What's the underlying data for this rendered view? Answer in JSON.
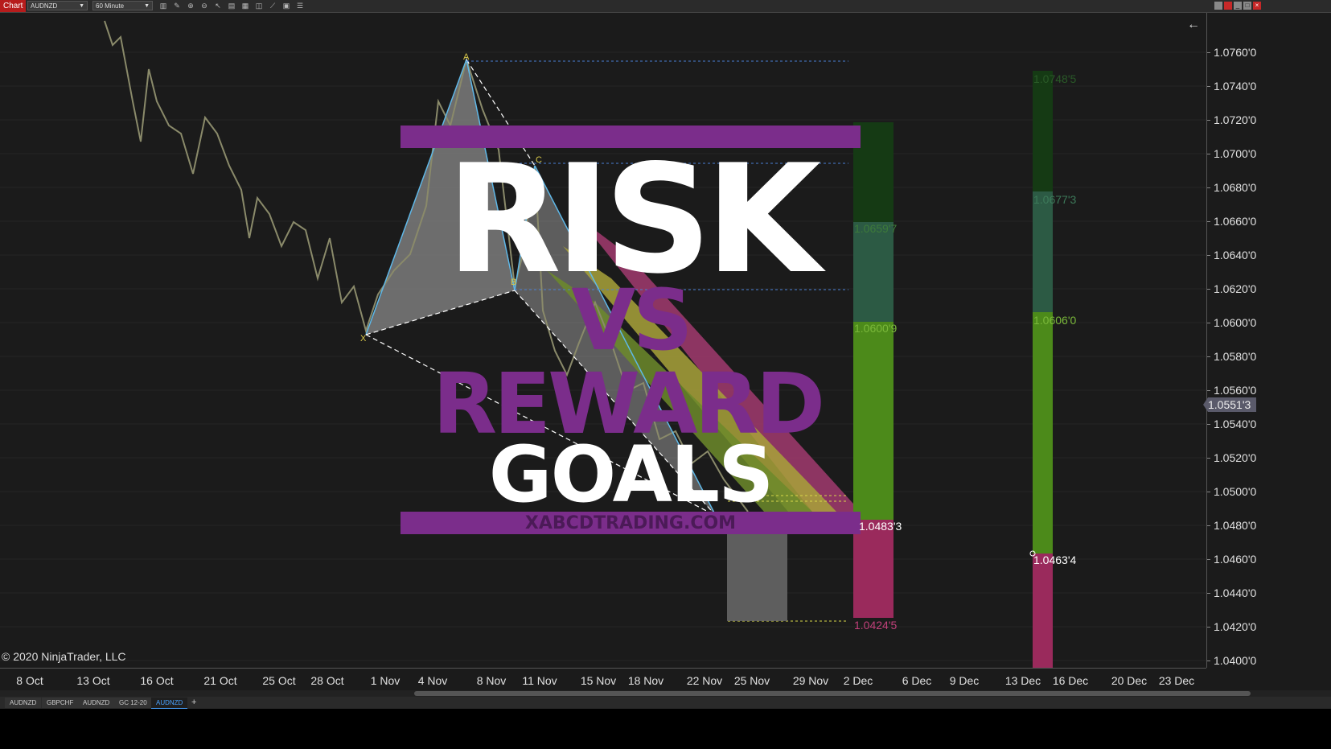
{
  "toolbar": {
    "chart_label": "Chart",
    "instrument": "AUDNZD",
    "interval": "60 Minute",
    "icons": [
      "bars-icon",
      "draw-icon",
      "zoom-in-icon",
      "zoom-out-icon",
      "pointer-icon",
      "properties-icon",
      "templates-icon",
      "snapshot-icon",
      "strategy-icon",
      "calculator-icon",
      "list-icon"
    ]
  },
  "chart": {
    "copyright": "© 2020 NinjaTrader, LLC",
    "current_price": "1.0551'3",
    "price_axis": [
      "1.0760'0",
      "1.0740'0",
      "1.0720'0",
      "1.0700'0",
      "1.0680'0",
      "1.0660'0",
      "1.0640'0",
      "1.0620'0",
      "1.0600'0",
      "1.0580'0",
      "1.0560'0",
      "1.0540'0",
      "1.0520'0",
      "1.0500'0",
      "1.0480'0",
      "1.0460'0",
      "1.0440'0",
      "1.0420'0",
      "1.0400'0"
    ],
    "time_axis": [
      "8 Oct",
      "13 Oct",
      "16 Oct",
      "21 Oct",
      "25 Oct",
      "28 Oct",
      "1 Nov",
      "4 Nov",
      "8 Nov",
      "11 Nov",
      "15 Nov",
      "18 Nov",
      "22 Nov",
      "25 Nov",
      "29 Nov",
      "2 Dec",
      "6 Dec",
      "9 Dec",
      "13 Dec",
      "16 Dec",
      "20 Dec",
      "23 Dec"
    ],
    "pattern_points": [
      "X",
      "A",
      "B",
      "C"
    ],
    "levels_left": [
      "1.0659'7",
      "1.0600'9",
      "1.0483'3",
      "1.0424'5"
    ],
    "levels_right": [
      "1.0748'5",
      "1.0677'3",
      "1.0606'0",
      "1.0463'4"
    ],
    "colors": {
      "target_dark": "#153a14",
      "target_mid": "#2c5a44",
      "target_light": "#4c8a1a",
      "stop": "#9a2a5c",
      "pattern_line": "#5fb8e8"
    }
  },
  "overlay": {
    "risk": "RISK",
    "vs": "VS",
    "reward": "REWARD",
    "goals": "GOALS",
    "site": "XABCDTRADING.COM",
    "accent": "#7b2d8b"
  },
  "tabs": [
    "AUDNZD",
    "GBPCHF",
    "AUDNZD",
    "GC 12-20",
    "AUDNZD",
    "+"
  ]
}
